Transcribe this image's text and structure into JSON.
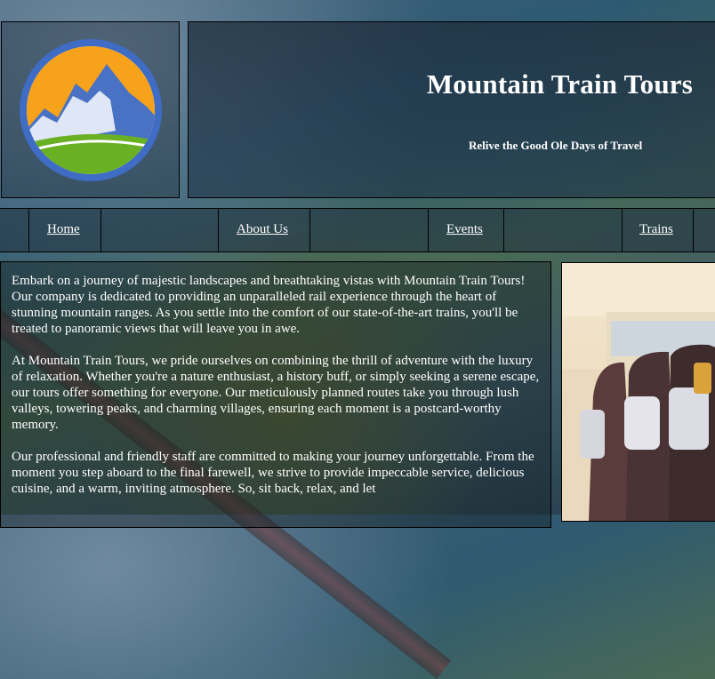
{
  "site": {
    "title": "Mountain Train Tours",
    "tagline": "Relive the Good Ole Days of Travel"
  },
  "nav": {
    "items": [
      {
        "label": "Home"
      },
      {
        "label": "About Us"
      },
      {
        "label": "Events"
      },
      {
        "label": "Trains"
      }
    ]
  },
  "content": {
    "paragraphs": [
      "Embark on a journey of majestic landscapes and breathtaking vistas with Mountain Train Tours! Our company is dedicated to providing an unparalleled rail experience through the heart of stunning mountain ranges. As you settle into the comfort of our state-of-the-art trains, you'll be treated to panoramic views that will leave you in awe.",
      "At Mountain Train Tours, we pride ourselves on combining the thrill of adventure with the luxury of relaxation. Whether you're a nature enthusiast, a history buff, or simply seeking a serene escape, our tours offer something for everyone. Our meticulously planned routes take you through lush valleys, towering peaks, and charming villages, ensuring each moment is a postcard-worthy memory.",
      "Our professional and friendly staff are committed to making your journey unforgettable. From the moment you step aboard to the final farewell, we strive to provide impeccable service, delicious cuisine, and a warm, inviting atmosphere. So, sit back, relax, and let"
    ]
  },
  "colors": {
    "logo_ring": "#3f6cc4",
    "logo_sun": "#f7a21b",
    "logo_grass": "#6ab023",
    "logo_mountain": "#4a72c4"
  },
  "icons": {
    "logo": "mountain-logo-icon",
    "photo": "train-seats-photo"
  }
}
